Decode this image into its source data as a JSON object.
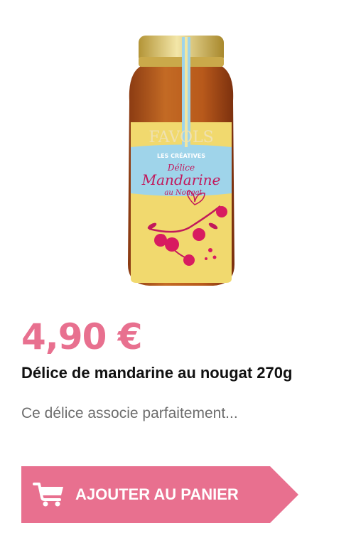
{
  "product": {
    "image": {
      "brand": "FAVOLS",
      "line": "LES CRÉATIVES",
      "name_line1": "Délice",
      "name_line2": "Mandarine",
      "name_line3": "au Nougat"
    },
    "price": "4,90 €",
    "title": "Délice de mandarine au nougat 270g",
    "description": "Ce délice associe parfaitement..."
  },
  "cart_button": {
    "label": "AJOUTER AU PANIER",
    "icon": "shopping-cart-icon"
  },
  "colors": {
    "accent": "#e8708f",
    "title": "#111111",
    "description": "#6d6d6d"
  }
}
